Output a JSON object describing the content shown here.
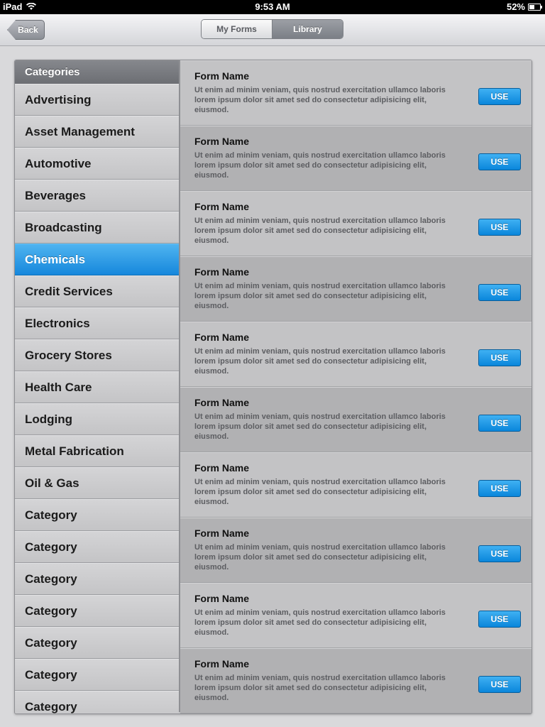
{
  "status_bar": {
    "carrier": "iPad",
    "time": "9:53 AM",
    "battery": "52%",
    "battery_level": 0.52
  },
  "nav": {
    "back_label": "Back",
    "segments": [
      {
        "label": "My Forms",
        "selected": false
      },
      {
        "label": "Library",
        "selected": true
      }
    ]
  },
  "categories": {
    "header": "Categories",
    "selected_index": 5,
    "items": [
      "Advertising",
      "Asset Management",
      "Automotive",
      "Beverages",
      "Broadcasting",
      "Chemicals",
      "Credit Services",
      "Electronics",
      "Grocery Stores",
      "Health Care",
      "Lodging",
      "Metal Fabrication",
      "Oil & Gas",
      "Category",
      "Category",
      "Category",
      "Category",
      "Category",
      "Category",
      "Category"
    ]
  },
  "forms": [
    {
      "name": "Form Name",
      "description": "Ut enim ad minim veniam, quis nostrud exercitation ullamco laboris lorem ipsum dolor sit amet sed do consectetur adipisicing elit, eiusmod.",
      "button": "USE"
    },
    {
      "name": "Form Name",
      "description": "Ut enim ad minim veniam, quis nostrud exercitation ullamco laboris lorem ipsum dolor sit amet sed do consectetur adipisicing elit, eiusmod.",
      "button": "USE"
    },
    {
      "name": "Form Name",
      "description": "Ut enim ad minim veniam, quis nostrud exercitation ullamco laboris lorem ipsum dolor sit amet sed do consectetur adipisicing elit, eiusmod.",
      "button": "USE"
    },
    {
      "name": "Form Name",
      "description": "Ut enim ad minim veniam, quis nostrud exercitation ullamco laboris lorem ipsum dolor sit amet sed do consectetur adipisicing elit, eiusmod.",
      "button": "USE"
    },
    {
      "name": "Form Name",
      "description": "Ut enim ad minim veniam, quis nostrud exercitation ullamco laboris lorem ipsum dolor sit amet sed do consectetur adipisicing elit, eiusmod.",
      "button": "USE"
    },
    {
      "name": "Form Name",
      "description": "Ut enim ad minim veniam, quis nostrud exercitation ullamco laboris lorem ipsum dolor sit amet sed do consectetur adipisicing elit, eiusmod.",
      "button": "USE"
    },
    {
      "name": "Form Name",
      "description": "Ut enim ad minim veniam, quis nostrud exercitation ullamco laboris lorem ipsum dolor sit amet sed do consectetur adipisicing elit, eiusmod.",
      "button": "USE"
    },
    {
      "name": "Form Name",
      "description": "Ut enim ad minim veniam, quis nostrud exercitation ullamco laboris lorem ipsum dolor sit amet sed do consectetur adipisicing elit, eiusmod.",
      "button": "USE"
    },
    {
      "name": "Form Name",
      "description": "Ut enim ad minim veniam, quis nostrud exercitation ullamco laboris lorem ipsum dolor sit amet sed do consectetur adipisicing elit, eiusmod.",
      "button": "USE"
    },
    {
      "name": "Form Name",
      "description": "Ut enim ad minim veniam, quis nostrud exercitation ullamco laboris lorem ipsum dolor sit amet sed do consectetur adipisicing elit, eiusmod.",
      "button": "USE"
    }
  ],
  "colors": {
    "accent": "#1687dc",
    "button": "#0a86db",
    "background": "#d9d9db"
  }
}
